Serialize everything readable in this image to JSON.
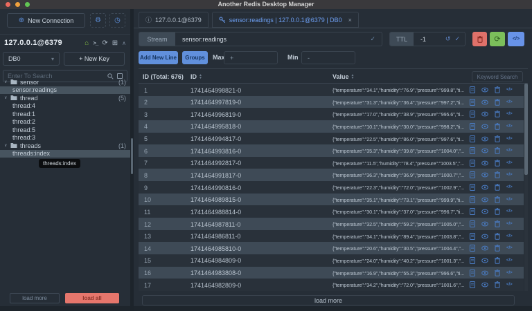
{
  "window": {
    "title": "Another Redis Desktop Manager"
  },
  "colors": {
    "accent_blue": "#6190dc",
    "tab_active_blue": "#6d9ff2",
    "danger_red": "#e0716a",
    "success_green": "#7cbf5b",
    "load_all_salmon": "#e5766c",
    "row_dark": "#29313a",
    "row_light": "#3e4a56",
    "icon_blue": "#4a7cc4",
    "home_green": "#7cb342"
  },
  "icons": {
    "plus_circle": "⊕",
    "gear": "⚙",
    "clock": "◷",
    "home": "⌂",
    "terminal": ">_",
    "refresh": "⟳",
    "grid": "⊞",
    "collapse": "∧",
    "chevron_down": "▾",
    "check": "✓",
    "undo": "↺",
    "close": "×",
    "info": "ⓘ",
    "caret_down": "∨",
    "sort_up": "▲",
    "sort_down": "▼",
    "code": "</>"
  },
  "sidebar": {
    "new_connection_label": "New Connection",
    "connection_name": "127.0.0.1@6379",
    "db_select": "DB0",
    "new_key_label": "+ New Key",
    "search_placeholder": "Enter To Search",
    "tree": [
      {
        "label": "sensor",
        "count": "(1)",
        "children": [
          {
            "label": "sensor:readings",
            "selected": true
          }
        ]
      },
      {
        "label": "thread",
        "count": "(5)",
        "children": [
          {
            "label": "thread:4",
            "selected": false
          },
          {
            "label": "thread:1",
            "selected": false
          },
          {
            "label": "thread:2",
            "selected": false
          },
          {
            "label": "thread:5",
            "selected": false
          },
          {
            "label": "thread:3",
            "selected": false
          }
        ]
      },
      {
        "label": "threads",
        "count": "(1)",
        "children": [
          {
            "label": "threads:index",
            "selected": true
          }
        ]
      }
    ],
    "tooltip": "threads:index",
    "load_more_label": "load more",
    "load_all_label": "load all"
  },
  "tabs": [
    {
      "label": "127.0.0.1@6379",
      "active": false
    },
    {
      "label": "sensor:readings | 127.0.0.1@6379 | DB0",
      "active": true
    }
  ],
  "toolbar": {
    "stream_label": "Stream",
    "stream_value": "sensor:readings",
    "ttl_label": "TTL",
    "ttl_value": "-1",
    "add_new_line_label": "Add New Line",
    "groups_label": "Groups",
    "max_label": "Max",
    "max_value": "+",
    "min_label": "Min",
    "min_value": "-"
  },
  "table": {
    "header": {
      "id_total": "ID (Total: 676)",
      "id": "ID",
      "value": "Value",
      "keyword_search": "Keyword Search"
    },
    "rows": [
      {
        "num": "1",
        "id": "1741464998821-0",
        "value": "{\"temperature\":\"34.1\",\"humidity\":\"76.9\",\"pressure\":\"999.8\",\"ti..."
      },
      {
        "num": "2",
        "id": "1741464997819-0",
        "value": "{\"temperature\":\"31.3\",\"humidity\":\"36.4\",\"pressure\":\"997.2\",\"ti..."
      },
      {
        "num": "3",
        "id": "1741464996819-0",
        "value": "{\"temperature\":\"17.0\",\"humidity\":\"38.9\",\"pressure\":\"995.6\",\"ti..."
      },
      {
        "num": "4",
        "id": "1741464995818-0",
        "value": "{\"temperature\":\"10.1\",\"humidity\":\"30.0\",\"pressure\":\"998.2\",\"ti..."
      },
      {
        "num": "5",
        "id": "1741464994817-0",
        "value": "{\"temperature\":\"22.5\",\"humidity\":\"86.0\",\"pressure\":\"997.6\",\"ti..."
      },
      {
        "num": "6",
        "id": "1741464993816-0",
        "value": "{\"temperature\":\"35.3\",\"humidity\":\"39.8\",\"pressure\":\"1004.0\",\"..."
      },
      {
        "num": "7",
        "id": "1741464992817-0",
        "value": "{\"temperature\":\"11.5\",\"humidity\":\"78.4\",\"pressure\":\"1003.5\",\"..."
      },
      {
        "num": "8",
        "id": "1741464991817-0",
        "value": "{\"temperature\":\"36.3\",\"humidity\":\"36.9\",\"pressure\":\"1000.7\",\"..."
      },
      {
        "num": "9",
        "id": "1741464990816-0",
        "value": "{\"temperature\":\"22.3\",\"humidity\":\"72.0\",\"pressure\":\"1002.9\",\"..."
      },
      {
        "num": "10",
        "id": "1741464989815-0",
        "value": "{\"temperature\":\"35.1\",\"humidity\":\"73.1\",\"pressure\":\"999.9\",\"ti..."
      },
      {
        "num": "11",
        "id": "1741464988814-0",
        "value": "{\"temperature\":\"30.1\",\"humidity\":\"37.0\",\"pressure\":\"996.7\",\"ti..."
      },
      {
        "num": "12",
        "id": "1741464987811-0",
        "value": "{\"temperature\":\"32.5\",\"humidity\":\"59.2\",\"pressure\":\"1005.0\",\"..."
      },
      {
        "num": "13",
        "id": "1741464986811-0",
        "value": "{\"temperature\":\"34.1\",\"humidity\":\"89.4\",\"pressure\":\"1003.8\",\"..."
      },
      {
        "num": "14",
        "id": "1741464985810-0",
        "value": "{\"temperature\":\"20.6\",\"humidity\":\"30.5\",\"pressure\":\"1004.4\",\"..."
      },
      {
        "num": "15",
        "id": "1741464984809-0",
        "value": "{\"temperature\":\"24.0\",\"humidity\":\"40.2\",\"pressure\":\"1001.3\",\"..."
      },
      {
        "num": "16",
        "id": "1741464983808-0",
        "value": "{\"temperature\":\"16.9\",\"humidity\":\"55.3\",\"pressure\":\"996.6\",\"ti..."
      },
      {
        "num": "17",
        "id": "1741464982809-0",
        "value": "{\"temperature\":\"34.2\",\"humidity\":\"72.0\",\"pressure\":\"1001.6\",\"..."
      }
    ],
    "load_more_label": "load more"
  }
}
